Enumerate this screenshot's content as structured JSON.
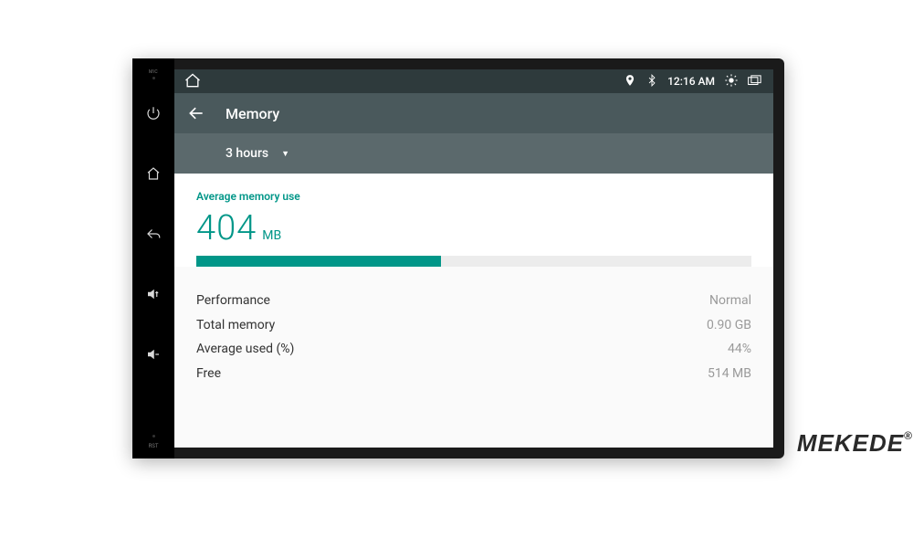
{
  "brand": {
    "name": "MEKEDE",
    "reg": "®"
  },
  "hw": {
    "mic": "MIC",
    "rst": "RST"
  },
  "status": {
    "time": "12:16 AM"
  },
  "app": {
    "title": "Memory"
  },
  "period": {
    "label": "3 hours"
  },
  "memory": {
    "section_title": "Average memory use",
    "value": "404",
    "unit": "MB",
    "bar_percent": 44
  },
  "details": {
    "performance_label": "Performance",
    "performance_value": "Normal",
    "total_label": "Total memory",
    "total_value": "0.90 GB",
    "avg_label": "Average used (%)",
    "avg_value": "44%",
    "free_label": "Free",
    "free_value": "514 MB"
  }
}
